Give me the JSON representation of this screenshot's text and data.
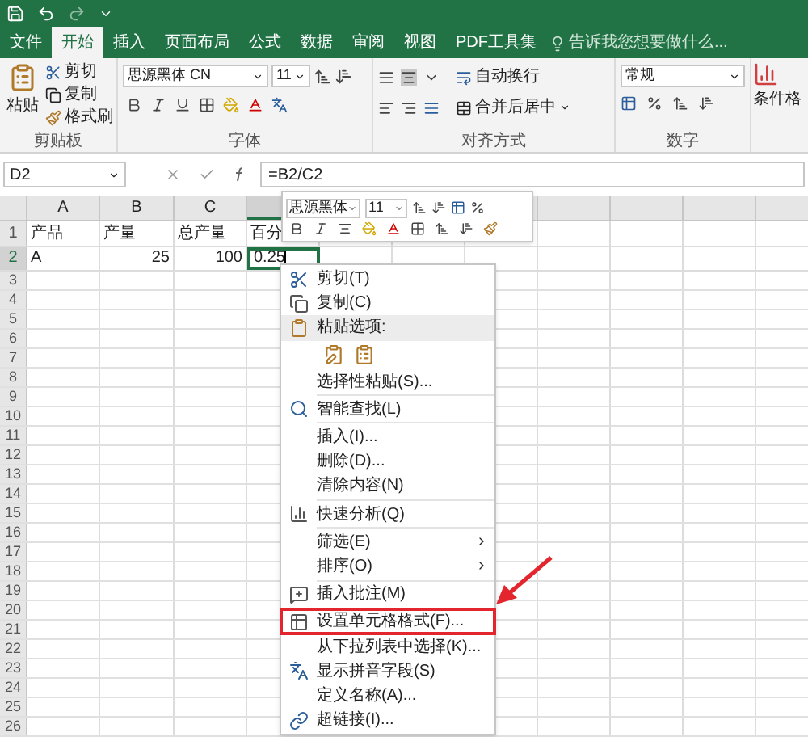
{
  "tabs": [
    {
      "label": "文件",
      "selected": false
    },
    {
      "label": "开始",
      "selected": true
    },
    {
      "label": "插入",
      "selected": false
    },
    {
      "label": "页面布局",
      "selected": false
    },
    {
      "label": "公式",
      "selected": false
    },
    {
      "label": "数据",
      "selected": false
    },
    {
      "label": "审阅",
      "selected": false
    },
    {
      "label": "视图",
      "selected": false
    },
    {
      "label": "PDF工具集",
      "selected": false
    }
  ],
  "tell_me": {
    "placeholder": "告诉我您想要做什么..."
  },
  "ribbon": {
    "clipboard": {
      "paste": "粘贴",
      "cut": "剪切",
      "copy": "复制",
      "format_painter": "格式刷",
      "label": "剪贴板"
    },
    "font": {
      "font_name": "思源黑体 CN",
      "font_size": "11",
      "label": "字体"
    },
    "alignment": {
      "wrap": "自动换行",
      "merge": "合并后居中",
      "label": "对齐方式"
    },
    "number": {
      "format": "常规",
      "label": "数字"
    },
    "styles": {
      "conditional": "条件格"
    }
  },
  "formula_bar": {
    "name_box": "D2",
    "formula": "=B2/C2"
  },
  "sheet": {
    "editing": true,
    "columns": [
      "A",
      "B",
      "C"
    ],
    "rows": [
      {
        "number": "1",
        "cells": [
          {
            "text": "产品",
            "numeric": false,
            "selected": false
          },
          {
            "text": "产量",
            "numeric": false,
            "selected": false
          },
          {
            "text": "总产量",
            "numeric": false,
            "selected": false
          },
          {
            "text": "百分",
            "numeric": false,
            "selected": false
          }
        ]
      },
      {
        "number": "2",
        "cells": [
          {
            "text": "A",
            "numeric": false,
            "selected": false
          },
          {
            "text": "25",
            "numeric": true,
            "selected": false
          },
          {
            "text": "100",
            "numeric": true,
            "selected": false
          },
          {
            "text": "0.25",
            "numeric": false,
            "selected": true
          }
        ]
      }
    ],
    "row_numbers": [
      "3",
      "4",
      "5",
      "6",
      "7",
      "8",
      "9",
      "10",
      "11",
      "12",
      "13",
      "14",
      "15",
      "16",
      "17",
      "18",
      "19",
      "20",
      "21",
      "22",
      "23",
      "24",
      "25",
      "26"
    ]
  },
  "mini_toolbar": {
    "font_name": "思源黑体",
    "font_size": "11"
  },
  "context_menu": {
    "items": [
      {
        "kind": "item",
        "label": "剪切(T)",
        "submenu": false,
        "highlighted": false
      },
      {
        "kind": "item",
        "label": "复制(C)",
        "submenu": false,
        "highlighted": false
      },
      {
        "kind": "header",
        "label": "粘贴选项:",
        "submenu": false,
        "highlighted": false
      },
      {
        "kind": "paste_icons"
      },
      {
        "kind": "item",
        "label": "选择性粘贴(S)...",
        "submenu": false,
        "highlighted": false
      },
      {
        "kind": "separator"
      },
      {
        "kind": "item",
        "label": "智能查找(L)",
        "submenu": false,
        "highlighted": false
      },
      {
        "kind": "separator"
      },
      {
        "kind": "item",
        "label": "插入(I)...",
        "submenu": false,
        "highlighted": false
      },
      {
        "kind": "item",
        "label": "删除(D)...",
        "submenu": false,
        "highlighted": false
      },
      {
        "kind": "item",
        "label": "清除内容(N)",
        "submenu": false,
        "highlighted": false
      },
      {
        "kind": "separator"
      },
      {
        "kind": "item",
        "label": "快速分析(Q)",
        "submenu": false,
        "highlighted": false
      },
      {
        "kind": "separator"
      },
      {
        "kind": "item",
        "label": "筛选(E)",
        "submenu": true,
        "highlighted": false
      },
      {
        "kind": "item",
        "label": "排序(O)",
        "submenu": true,
        "highlighted": false
      },
      {
        "kind": "separator"
      },
      {
        "kind": "item",
        "label": "插入批注(M)",
        "submenu": false,
        "highlighted": false
      },
      {
        "kind": "separator"
      },
      {
        "kind": "item",
        "label": "设置单元格格式(F)...",
        "submenu": false,
        "highlighted": true
      },
      {
        "kind": "item",
        "label": "从下拉列表中选择(K)...",
        "submenu": false,
        "highlighted": false
      },
      {
        "kind": "item",
        "label": "显示拼音字段(S)",
        "submenu": false,
        "highlighted": false
      },
      {
        "kind": "item",
        "label": "定义名称(A)...",
        "submenu": false,
        "highlighted": false
      },
      {
        "kind": "item",
        "label": "超链接(I)...",
        "submenu": false,
        "highlighted": false
      }
    ]
  }
}
